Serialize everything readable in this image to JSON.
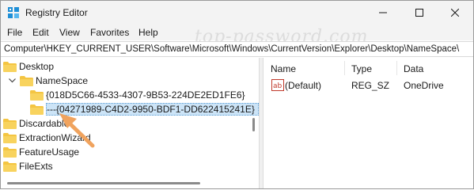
{
  "window": {
    "title": "Registry Editor"
  },
  "menu": [
    {
      "label": "File"
    },
    {
      "label": "Edit"
    },
    {
      "label": "View"
    },
    {
      "label": "Favorites"
    },
    {
      "label": "Help"
    }
  ],
  "address": {
    "path": "Computer\\HKEY_CURRENT_USER\\Software\\Microsoft\\Windows\\CurrentVersion\\Explorer\\Desktop\\NameSpace\\"
  },
  "watermark": "top-password.com",
  "tree": {
    "items": [
      {
        "label": "Desktop",
        "expanded": true
      },
      {
        "label": "NameSpace",
        "expanded": true
      },
      {
        "label": "{018D5C66-4533-4307-9B53-224DE2ED1FE6}"
      },
      {
        "label": "---{04271989-C4D2-9950-BDF1-DD622415241E}",
        "selected": true
      },
      {
        "label": "Discardable"
      },
      {
        "label": "ExtractionWizard"
      },
      {
        "label": "FeatureUsage"
      },
      {
        "label": "FileExts"
      }
    ]
  },
  "list": {
    "columns": [
      {
        "label": "Name"
      },
      {
        "label": "Type"
      },
      {
        "label": "Data"
      }
    ],
    "rows": [
      {
        "name": "(Default)",
        "type": "REG_SZ",
        "data": "OneDrive",
        "icon": "string-value-icon"
      }
    ]
  },
  "colors": {
    "selection": "#cce4f7",
    "folder": "#f4c542",
    "arrow": "#f0a35e",
    "title_icon": "#1f8fd6"
  }
}
